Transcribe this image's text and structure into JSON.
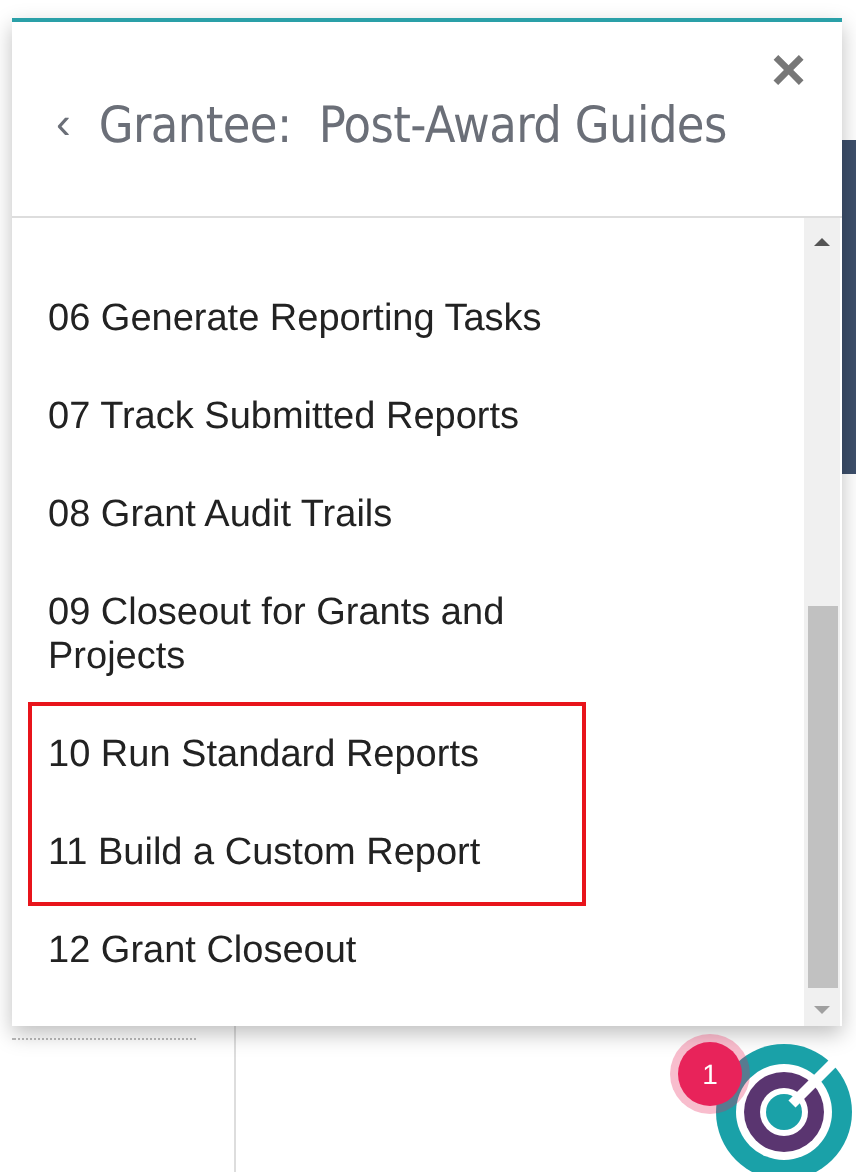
{
  "panel": {
    "title": "Grantee:  Post-Award Guides",
    "back_icon": "‹",
    "close_icon": "×"
  },
  "items": [
    {
      "label": "06 Generate Reporting Tasks",
      "highlighted": false
    },
    {
      "label": "07 Track Submitted Reports",
      "highlighted": false
    },
    {
      "label": "08 Grant Audit Trails",
      "highlighted": false
    },
    {
      "label": "09 Closeout for Grants and Projects",
      "highlighted": false
    },
    {
      "label": "10 Run Standard Reports",
      "highlighted": true
    },
    {
      "label": "11 Build a Custom Report",
      "highlighted": true
    },
    {
      "label": "12 Grant Closeout",
      "highlighted": false
    }
  ],
  "notification_badge": "1"
}
